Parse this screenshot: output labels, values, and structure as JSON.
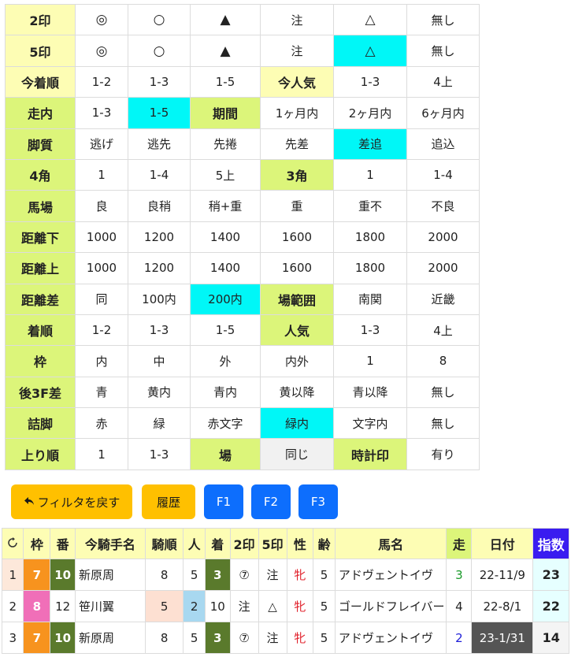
{
  "filters": [
    {
      "label": "2印",
      "cells": [
        "◎",
        "○",
        "▲",
        "注",
        "△",
        "無し"
      ]
    },
    {
      "label": "5印",
      "cells": [
        "◎",
        "○",
        "▲",
        "注",
        "△",
        "無し"
      ]
    },
    {
      "label": "今着順",
      "cells": [
        "1-2",
        "1-3",
        "1-5"
      ],
      "label2": "今人気",
      "cells2": [
        "1-3",
        "4上"
      ]
    },
    {
      "label": "走内",
      "cells": [
        "1-3",
        "1-5"
      ],
      "label2": "期間",
      "cells2": [
        "1ヶ月内",
        "2ヶ月内",
        "6ヶ月内"
      ]
    },
    {
      "label": "脚質",
      "cells": [
        "逃げ",
        "逃先",
        "先捲",
        "先差",
        "差追",
        "追込"
      ]
    },
    {
      "label": "4角",
      "cells": [
        "1",
        "1-4",
        "5上"
      ],
      "label2": "3角",
      "cells2": [
        "1",
        "1-4"
      ]
    },
    {
      "label": "馬場",
      "cells": [
        "良",
        "良稍",
        "稍+重",
        "重",
        "重不",
        "不良"
      ]
    },
    {
      "label": "距離下",
      "cells": [
        "1000",
        "1200",
        "1400",
        "1600",
        "1800",
        "2000"
      ]
    },
    {
      "label": "距離上",
      "cells": [
        "1000",
        "1200",
        "1400",
        "1600",
        "1800",
        "2000"
      ]
    },
    {
      "label": "距離差",
      "cells": [
        "同",
        "100内",
        "200内"
      ],
      "label2": "場範囲",
      "cells2": [
        "南関",
        "近畿"
      ]
    },
    {
      "label": "着順",
      "cells": [
        "1-2",
        "1-3",
        "1-5"
      ],
      "label2": "人気",
      "cells2": [
        "1-3",
        "4上"
      ]
    },
    {
      "label": "枠",
      "cells": [
        "内",
        "中",
        "外",
        "内外",
        "1",
        "8"
      ]
    },
    {
      "label": "後3F差",
      "cells": [
        "青",
        "黄内",
        "青内",
        "黄以降",
        "青以降",
        "無し"
      ]
    },
    {
      "label": "詰脚",
      "cells": [
        "赤",
        "緑",
        "赤文字",
        "緑内",
        "文字内",
        "無し"
      ]
    },
    {
      "label": "上り順",
      "cells": [
        "1",
        "1-3"
      ],
      "label2": "場",
      "cells2": [
        "同じ"
      ],
      "label3": "時計印",
      "cells3": [
        "有り"
      ]
    }
  ],
  "buttons": {
    "reset": "フィルタを戻す",
    "history": "履歴",
    "f1": "F1",
    "f2": "F2",
    "f3": "F3"
  },
  "race_table": {
    "headers": [
      "枠",
      "番",
      "今騎手名",
      "騎順",
      "人",
      "着",
      "2印",
      "5印",
      "性",
      "齢",
      "馬名",
      "走",
      "日付",
      "指数"
    ],
    "rows": [
      {
        "no": "1",
        "waku": "7",
        "ban": "10",
        "jockey": "新原周",
        "kijun": "8",
        "ninki": "5",
        "chaku": "3",
        "in2": "⑦",
        "in5": "注",
        "sex": "牝",
        "age": "5",
        "horse": "アドヴェントイヴ",
        "run": "3",
        "date": "22-11/9",
        "index": "23"
      },
      {
        "no": "2",
        "waku": "8",
        "ban": "12",
        "jockey": "笹川翼",
        "kijun": "5",
        "ninki": "2",
        "chaku": "10",
        "in2": "注",
        "in5": "△",
        "sex": "牝",
        "age": "5",
        "horse": "ゴールドフレイバー",
        "run": "4",
        "date": "22-8/1",
        "index": "22"
      },
      {
        "no": "3",
        "waku": "7",
        "ban": "10",
        "jockey": "新原周",
        "kijun": "8",
        "ninki": "5",
        "chaku": "3",
        "in2": "⑦",
        "in5": "注",
        "sex": "牝",
        "age": "5",
        "horse": "アドヴェントイヴ",
        "run": "2",
        "date": "23-1/31",
        "index": "14"
      }
    ]
  }
}
